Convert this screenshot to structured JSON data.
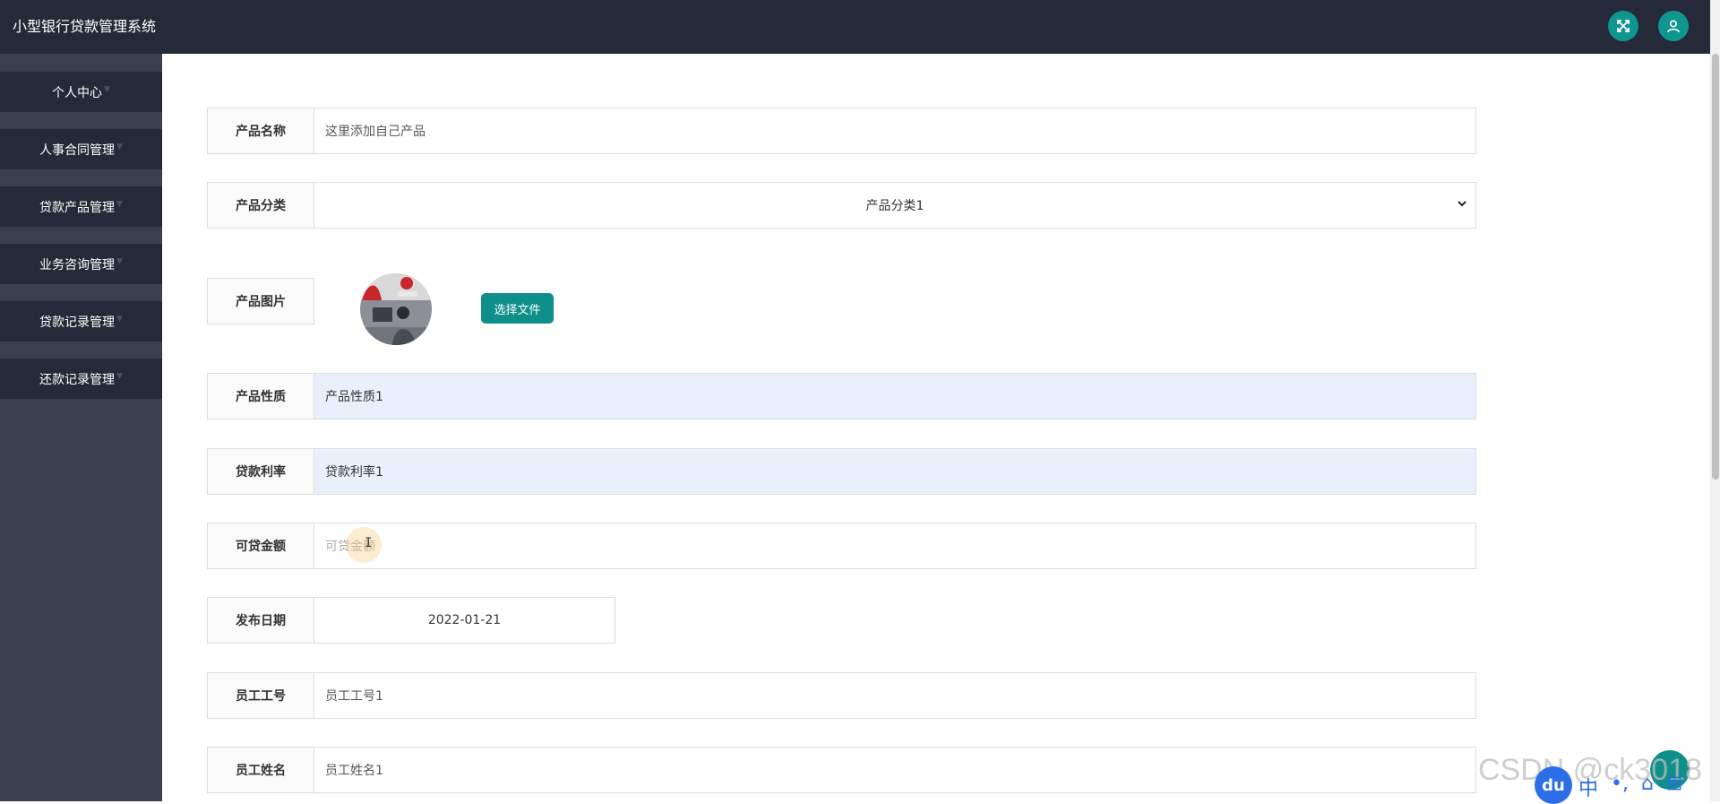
{
  "app": {
    "title": "小型银行贷款管理系统"
  },
  "topbar": {
    "icons": [
      "fullscreen-icon",
      "user-icon"
    ]
  },
  "sidebar": {
    "items": [
      {
        "label": "个人中心"
      },
      {
        "label": "人事合同管理"
      },
      {
        "label": "贷款产品管理"
      },
      {
        "label": "业务咨询管理"
      },
      {
        "label": "贷款记录管理"
      },
      {
        "label": "还款记录管理"
      }
    ]
  },
  "form": {
    "product_name": {
      "label": "产品名称",
      "value": "这里添加自己产品"
    },
    "product_category": {
      "label": "产品分类",
      "selected": "产品分类1"
    },
    "product_image": {
      "label": "产品图片",
      "button_label": "选择文件"
    },
    "product_nature": {
      "label": "产品性质",
      "value": "产品性质1"
    },
    "loan_rate": {
      "label": "贷款利率",
      "value": "贷款利率1"
    },
    "loanable_amount": {
      "label": "可贷金额",
      "placeholder": "可贷金额"
    },
    "publish_date": {
      "label": "发布日期",
      "value": "2022-01-21"
    },
    "employee_no": {
      "label": "员工工号",
      "value": "员工工号1"
    },
    "employee_name": {
      "label": "员工姓名",
      "value": "员工姓名1"
    }
  },
  "overlay": {
    "watermark": "CSDN @ck3018",
    "ime_logo": "du",
    "ime_mode": "中"
  },
  "colors": {
    "topbar": "#242a37",
    "sidebar": "#3a3f4d",
    "accent": "#0f8f8a",
    "readonly_field": "#e8f0fb"
  }
}
